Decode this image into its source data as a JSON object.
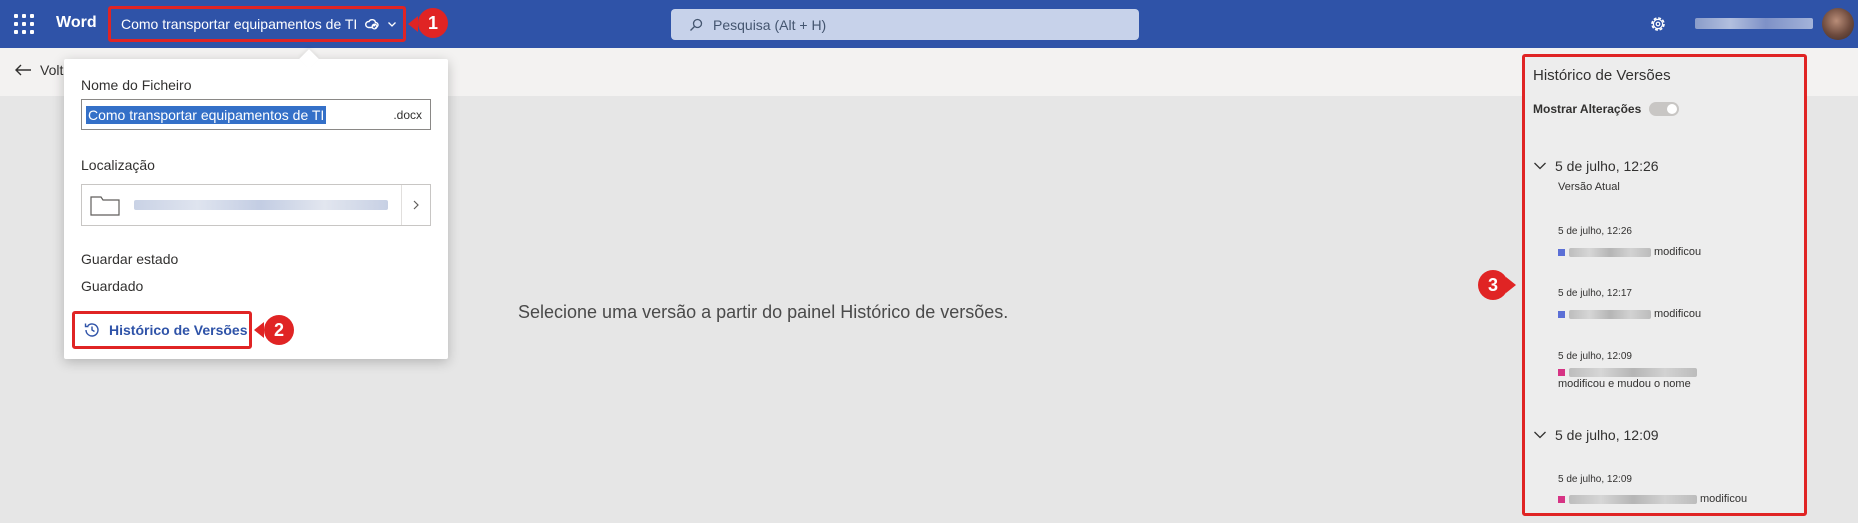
{
  "topbar": {
    "app_name": "Word",
    "doc_title": "Como transportar equipamentos de TI",
    "search_placeholder": "Pesquisa (Alt + H)"
  },
  "cmdbar": {
    "back_label": "Volt"
  },
  "main": {
    "message": "Selecione uma versão a partir do painel Histórico de versões."
  },
  "file_menu": {
    "filename_label": "Nome do Ficheiro",
    "filename_value": "Como transportar equipamentos de TI",
    "extension": ".docx",
    "location_label": "Localização",
    "save_state_label": "Guardar estado",
    "save_state_value": "Guardado",
    "version_history_label": "Histórico de Versões"
  },
  "badges": {
    "b1": "1",
    "b2": "2",
    "b3": "3"
  },
  "versions_panel": {
    "title": "Histórico de Versões",
    "show_changes_label": "Mostrar Alterações",
    "groups": [
      {
        "header": "5 de julho, 12:26",
        "current_label": "Versão Atual",
        "entries": [
          {
            "time": "5 de julho, 12:26",
            "action": "modificou",
            "color": "#5b6fd6"
          },
          {
            "time": "5 de julho, 12:17",
            "action": "modificou",
            "color": "#5b6fd6"
          },
          {
            "time": "5 de julho, 12:09",
            "action": "modificou e mudou o nome",
            "color": "#d63384"
          }
        ]
      },
      {
        "header": "5 de julho, 12:09",
        "entries": [
          {
            "time": "5 de julho, 12:09",
            "action": "modificou",
            "color": "#d63384"
          }
        ]
      }
    ]
  },
  "colors": {
    "accent": "#2f53a8",
    "highlight_red": "#e02424"
  },
  "icons": [
    "waffle-icon",
    "cloud-sync-icon",
    "chevron-down-icon",
    "search-icon",
    "gear-icon",
    "back-arrow-icon",
    "folder-icon",
    "chevron-right-icon",
    "history-icon"
  ]
}
